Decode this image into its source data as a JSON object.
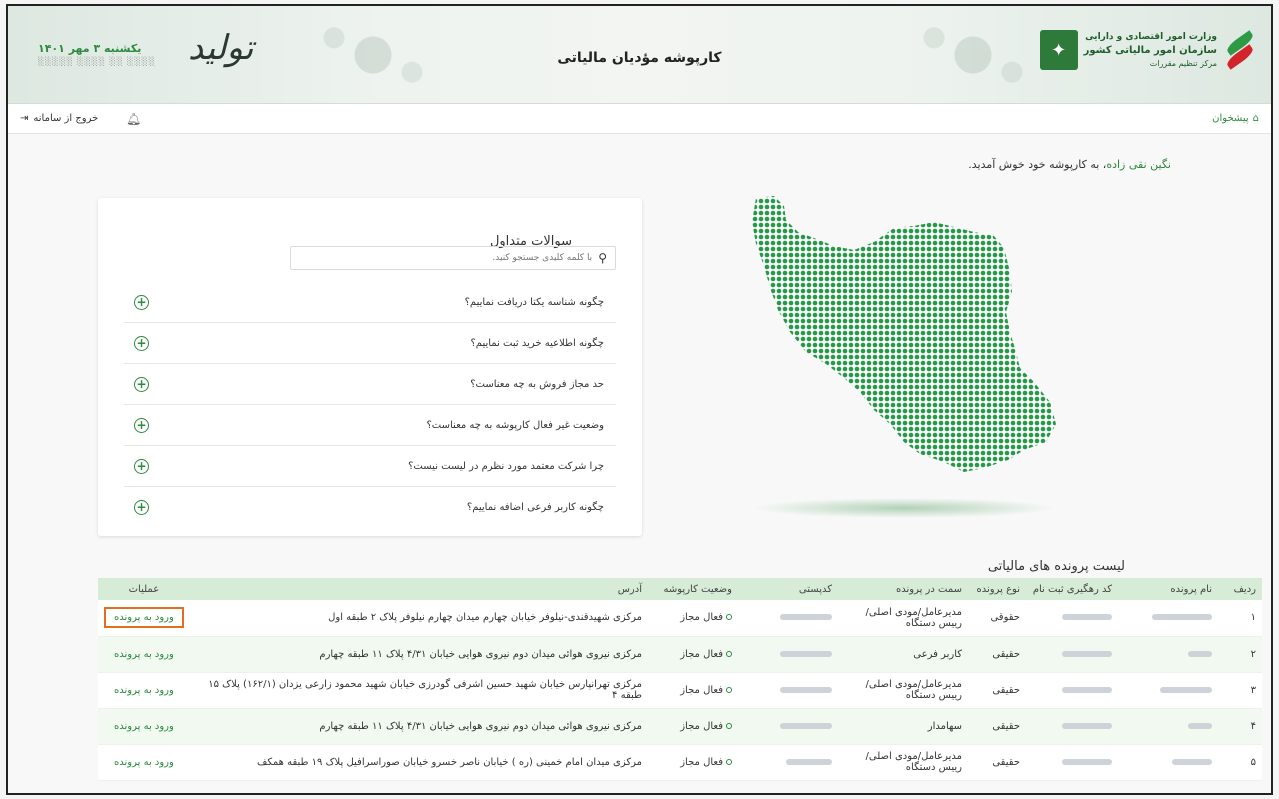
{
  "header": {
    "title": "کارپوشه مؤدیان مالیاتی",
    "date": "یکشنبه ۳ مهر ۱۴۰۱",
    "slogan": "تولید",
    "brand": {
      "line1": "وزارت امور اقتصادی و دارایی",
      "line2": "سازمان امور مالیاتی کشور",
      "line3": "مرکز تنظیم مقررات"
    }
  },
  "toolbar": {
    "home": "پیشخوان",
    "logout": "خروج از سامانه"
  },
  "welcome": {
    "name": "نگین نقی زاده",
    "message": "، به کارپوشه خود خوش آمدید."
  },
  "faq": {
    "title": "سوالات متداول",
    "search_placeholder": "با کلمه کلیدی جستجو کنید.",
    "items": [
      "چگونه شناسه یکتا دریافت نماییم؟",
      "چگونه اطلاعیه خرید ثبت نماییم؟",
      "حد مجاز فروش به چه معناست؟",
      "وضعیت غیر فعال کارپوشه به چه معناست؟",
      "چرا شرکت معتمد مورد نظرم در لیست نیست؟",
      "چگونه کاربر فرعی اضافه نماییم؟"
    ]
  },
  "table": {
    "title": "لیست پرونده های مالیاتی",
    "headers": [
      "ردیف",
      "نام پرونده",
      "کد رهگیری ثبت نام",
      "نوع پرونده",
      "سمت در پرونده",
      "کدپستی",
      "وضعیت کارپوشه",
      "آدرس",
      "عملیات"
    ],
    "rows": [
      {
        "index": "۱",
        "type": "حقوقی",
        "role": "مدیرعامل/مودی اصلی/رییس دستگاه",
        "status": "فعال مجاز",
        "address": "مرکزی شهیدقندی-نیلوفر خیابان چهارم میدان چهارم نیلوفر پلاک ۲ طبقه اول",
        "action": "ورود به پرونده"
      },
      {
        "index": "۲",
        "type": "حقیقی",
        "role": "کاربر فرعی",
        "status": "فعال مجاز",
        "address": "مرکزی نیروی هوائی میدان دوم نیروی هوایی خیابان ۴/۳۱ پلاک ۱۱ طبقه چهارم",
        "action": "ورود به پرونده"
      },
      {
        "index": "۳",
        "type": "حقیقی",
        "role": "مدیرعامل/مودی اصلی/رییس دستگاه",
        "status": "فعال مجاز",
        "address": "مرکزی تهرانپارس خیابان شهید حسین اشرفی گودرزی خیابان شهید محمود زارعی یزدان (۱۶۲/۱) پلاک ۱۵ طبقه ۴",
        "action": "ورود به پرونده"
      },
      {
        "index": "۴",
        "type": "حقیقی",
        "role": "سهامدار",
        "status": "فعال مجاز",
        "address": "مرکزی نیروی هوائی میدان دوم نیروی هوایی خیابان ۴/۳۱ پلاک ۱۱ طبقه چهارم",
        "action": "ورود به پرونده"
      },
      {
        "index": "۵",
        "type": "حقیقی",
        "role": "مدیرعامل/مودی اصلی/رییس دستگاه",
        "status": "فعال مجاز",
        "address": "مرکزی میدان امام خمینی (ره ) خیابان ناصر خسرو خیابان صوراسرافیل پلاک ۱۹ طبقه همکف",
        "action": "ورود به پرونده"
      }
    ]
  },
  "colors": {
    "accent": "#2e8a3f",
    "header_row": "#d6ecd6",
    "highlight": "#e07020"
  }
}
